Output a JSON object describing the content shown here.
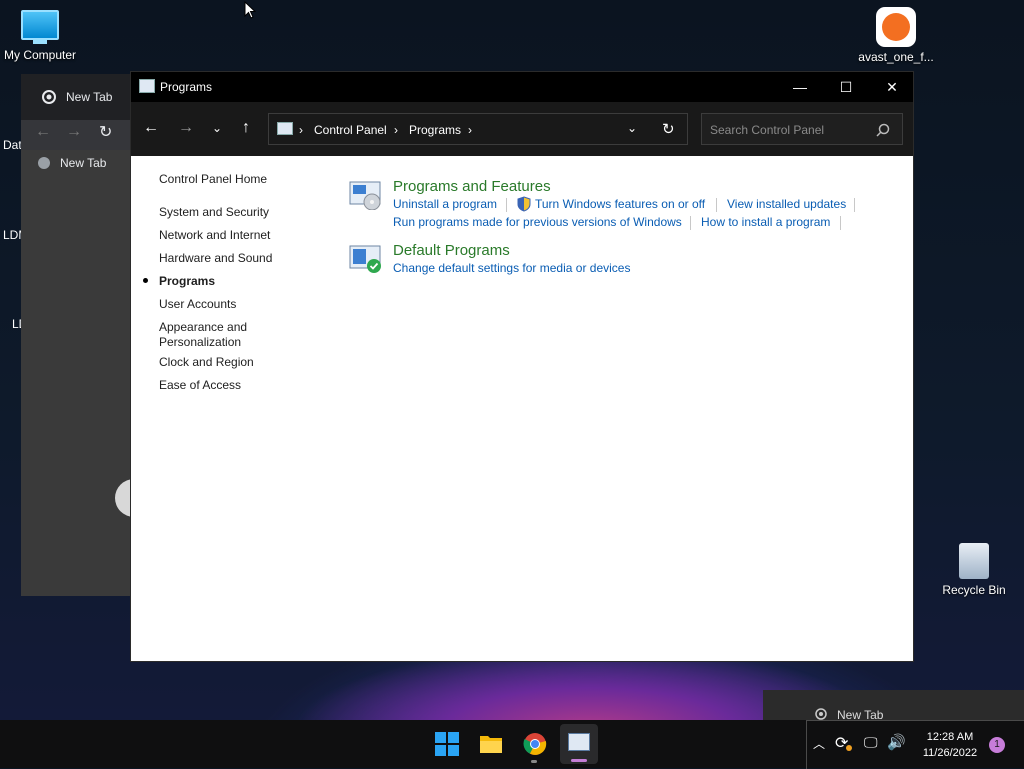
{
  "desktop": {
    "icons": {
      "my_computer": "My Computer",
      "avast": "avast_one_f...",
      "recycle_bin": "Recycle Bin",
      "partial_1": "Dat",
      "partial_2": "LDM",
      "partial_3": "LD"
    }
  },
  "background_browser": {
    "tab_label": "New Tab",
    "bookmark_label": "New Tab"
  },
  "window": {
    "title": "Programs",
    "breadcrumb": [
      "Control Panel",
      "Programs"
    ],
    "search_placeholder": "Search Control Panel"
  },
  "left_nav": {
    "home": "Control Panel Home",
    "items": [
      "System and Security",
      "Network and Internet",
      "Hardware and Sound",
      "Programs",
      "User Accounts",
      "Appearance and",
      "Personalization",
      "Clock and Region",
      "Ease of Access"
    ]
  },
  "sections": {
    "programs_features": {
      "title": "Programs and Features",
      "links": [
        "Uninstall a program",
        "Turn Windows features on or off",
        "View installed updates",
        "Run programs made for previous versions of Windows",
        "How to install a program"
      ]
    },
    "default_programs": {
      "title": "Default Programs",
      "links": [
        "Change default settings for media or devices"
      ]
    }
  },
  "taskbar": {
    "popup_label": "New Tab",
    "time": "12:28 AM",
    "date": "11/26/2022",
    "notification_count": "1"
  },
  "colors": {
    "section_title": "#2a7a2a",
    "link": "#0a5db3",
    "title_bar": "#000000"
  }
}
